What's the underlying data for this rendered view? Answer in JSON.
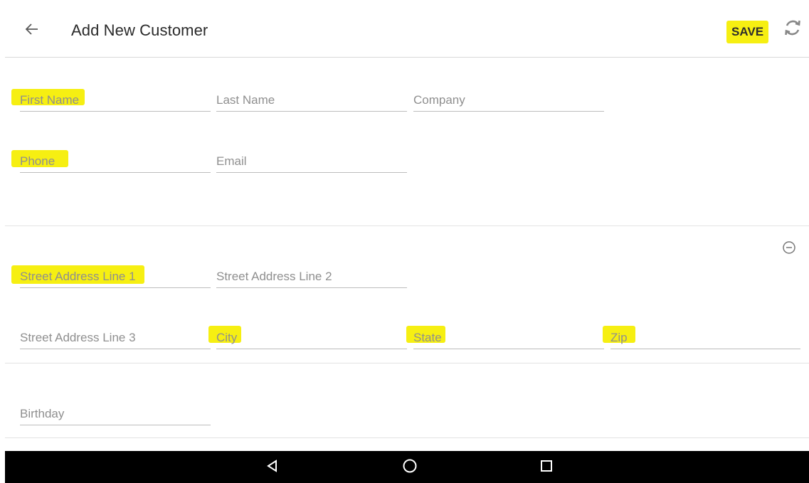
{
  "header": {
    "title": "Add New Customer",
    "save_label": "SAVE",
    "back_icon": "arrow-left-icon",
    "refresh_icon": "refresh-icon"
  },
  "contact": {
    "first_name": {
      "placeholder": "First Name",
      "value": ""
    },
    "last_name": {
      "placeholder": "Last Name",
      "value": ""
    },
    "company": {
      "placeholder": "Company",
      "value": ""
    },
    "phone": {
      "placeholder": "Phone",
      "value": ""
    },
    "email": {
      "placeholder": "Email",
      "value": ""
    }
  },
  "address": {
    "remove_icon": "minus-circle-icon",
    "line1": {
      "placeholder": "Street Address Line 1",
      "value": ""
    },
    "line2": {
      "placeholder": "Street Address Line 2",
      "value": ""
    },
    "line3": {
      "placeholder": "Street Address Line 3",
      "value": ""
    },
    "city": {
      "placeholder": "City",
      "value": ""
    },
    "state": {
      "placeholder": "State",
      "value": ""
    },
    "zip": {
      "placeholder": "Zip",
      "value": ""
    }
  },
  "extra": {
    "birthday": {
      "placeholder": "Birthday",
      "value": ""
    }
  },
  "navbar": {
    "back_icon": "nav-back-triangle-icon",
    "home_icon": "nav-home-circle-icon",
    "recents_icon": "nav-recents-square-icon"
  },
  "colors": {
    "highlight": "#f6ef12",
    "navbar": "#000000",
    "underline": "#bcbcbc"
  }
}
